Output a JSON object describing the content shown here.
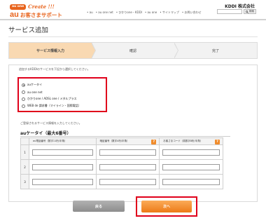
{
  "header": {
    "logo_chip": "au one",
    "logo_create": "Create !!!",
    "logo_au": "au",
    "logo_subtitle": "お客さまサポート",
    "company": "KDDI 株式会社",
    "nav": [
      "• au",
      "• au one net",
      "• ひかりone・KDDI",
      "• au one",
      "• サイトマップ",
      "• お問い合わせ"
    ],
    "search_button": "検索"
  },
  "page": {
    "title": "サービス追加"
  },
  "steps": [
    {
      "label": "サービス情報入力",
      "active": true
    },
    {
      "label": "確認",
      "active": false
    },
    {
      "label": "完了",
      "active": false
    }
  ],
  "form": {
    "instruction": "追加するKDDIのサービスを下記から選択してください。",
    "options": [
      {
        "label": "auケータイ",
        "checked": true
      },
      {
        "label": "au one net",
        "checked": false
      },
      {
        "label": "ひかりone / ADSL one / メタルプラス",
        "checked": false
      },
      {
        "label": "WEB de 請求書（マイライン・国際電話）",
        "checked": false
      }
    ],
    "sub_instruction": "ご登録されるサービス情報を入力してください。",
    "section_heading": "auケータイ（最大6番号）",
    "table": {
      "headers": [
        "au電話番号（数字11桁/半角）",
        "暗証番号（数字4桁/半角）",
        "お客さまコード（英数字8桁/半角）"
      ],
      "rows": [
        "1",
        "2",
        "3"
      ]
    }
  },
  "buttons": {
    "back": "戻る",
    "next": "次へ"
  },
  "colors": {
    "brand_orange": "#e8631c",
    "highlight_red": "#e0001b",
    "active_step": "#f9d9b2"
  }
}
